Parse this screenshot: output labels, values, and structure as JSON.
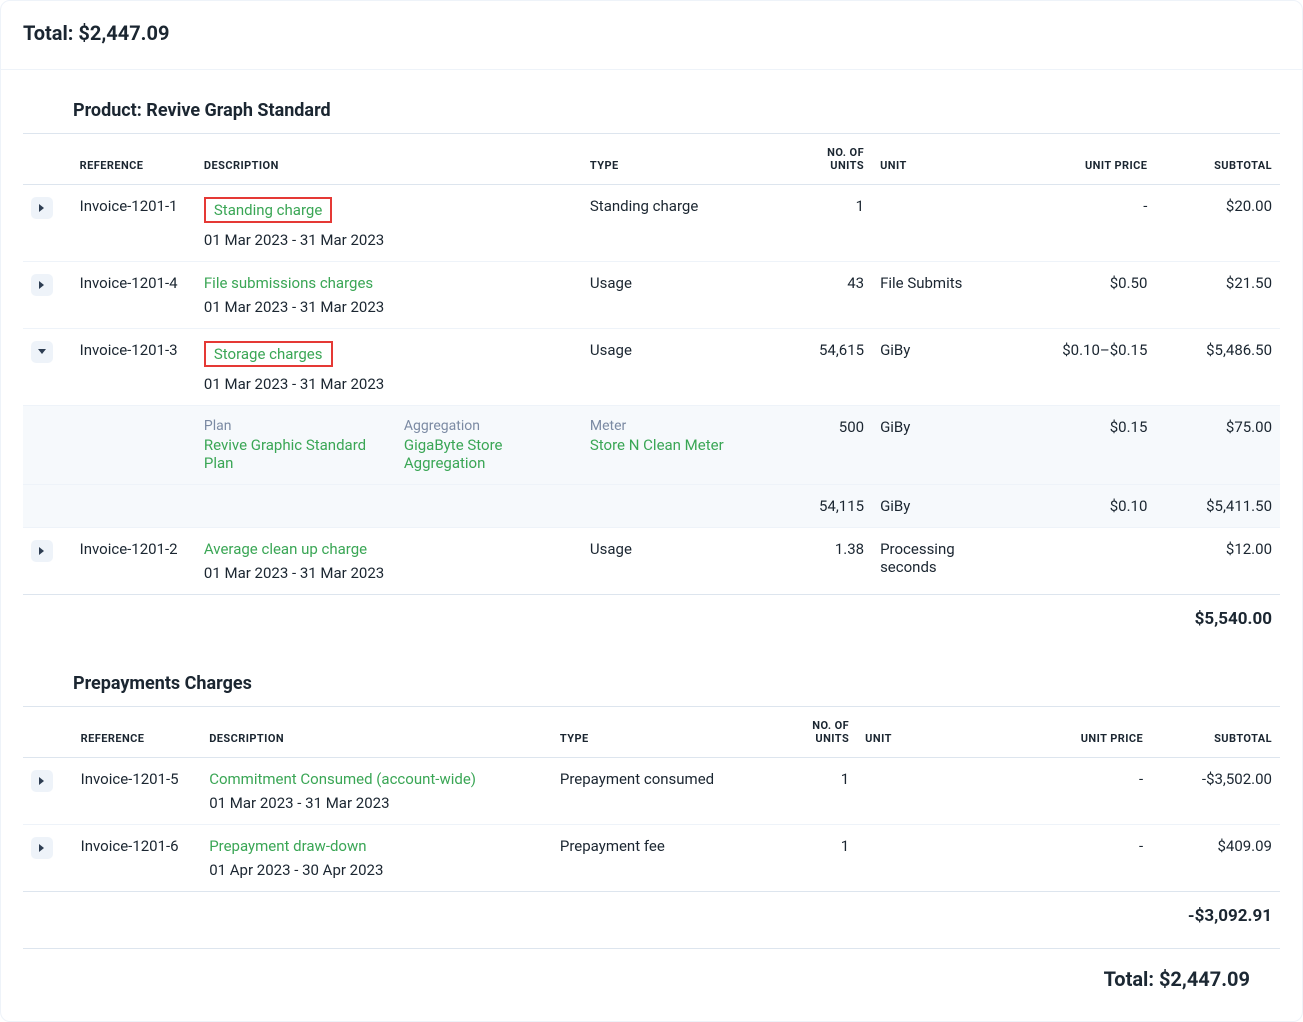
{
  "top_total_label": "Total: ",
  "top_total_value": "$2,447.09",
  "headers": {
    "reference": "REFERENCE",
    "description": "DESCRIPTION",
    "type": "TYPE",
    "units_l1": "NO. OF",
    "units_l2": "UNITS",
    "unit": "UNIT",
    "unit_price": "UNIT PRICE",
    "subtotal": "SUBTOTAL"
  },
  "product_section": {
    "title": "Product: Revive Graph Standard",
    "rows": [
      {
        "ref": "Invoice-1201-1",
        "name": "Standing charge",
        "daterange": "01 Mar 2023 - 31 Mar 2023",
        "type": "Standing charge",
        "units": "1",
        "unit": "",
        "unit_price": "-",
        "subtotal": "$20.00",
        "highlight": true,
        "expanded": false
      },
      {
        "ref": "Invoice-1201-4",
        "name": "File submissions charges",
        "daterange": "01 Mar 2023 - 31 Mar 2023",
        "type": "Usage",
        "units": "43",
        "unit": "File Submits",
        "unit_price": "$0.50",
        "subtotal": "$21.50",
        "highlight": false,
        "expanded": false
      },
      {
        "ref": "Invoice-1201-3",
        "name": "Storage charges",
        "daterange": "01 Mar 2023 - 31 Mar 2023",
        "type": "Usage",
        "units": "54,615",
        "unit": "GiBy",
        "unit_price": "$0.10–$0.15",
        "subtotal": "$5,486.50",
        "highlight": true,
        "expanded": true,
        "detail": {
          "plan_label": "Plan",
          "plan": "Revive Graphic Standard Plan",
          "agg_label": "Aggregation",
          "agg": "GigaByte Store Aggregation",
          "meter_label": "Meter",
          "meter": "Store N Clean Meter",
          "tiers": [
            {
              "units": "500",
              "unit": "GiBy",
              "price": "$0.15",
              "subtotal": "$75.00"
            },
            {
              "units": "54,115",
              "unit": "GiBy",
              "price": "$0.10",
              "subtotal": "$5,411.50"
            }
          ]
        }
      },
      {
        "ref": "Invoice-1201-2",
        "name": "Average clean up charge",
        "daterange": "01 Mar 2023 - 31 Mar 2023",
        "type": "Usage",
        "units": "1.38",
        "unit": "Processing seconds",
        "unit_price": "",
        "subtotal": "$12.00",
        "highlight": false,
        "expanded": false
      }
    ],
    "section_subtotal": "$5,540.00"
  },
  "prepayments_section": {
    "title": "Prepayments Charges",
    "rows": [
      {
        "ref": "Invoice-1201-5",
        "name": "Commitment Consumed (account-wide)",
        "daterange": "01 Mar 2023 - 31 Mar 2023",
        "type": "Prepayment consumed",
        "units": "1",
        "unit": "",
        "unit_price": "-",
        "subtotal": "-$3,502.00"
      },
      {
        "ref": "Invoice-1201-6",
        "name": "Prepayment draw-down",
        "daterange": "01 Apr 2023 - 30 Apr 2023",
        "type": "Prepayment fee",
        "units": "1",
        "unit": "",
        "unit_price": "-",
        "subtotal": "$409.09"
      }
    ],
    "section_subtotal": "-$3,092.91"
  },
  "grand_total_label": "Total: ",
  "grand_total_value": "$2,447.09"
}
